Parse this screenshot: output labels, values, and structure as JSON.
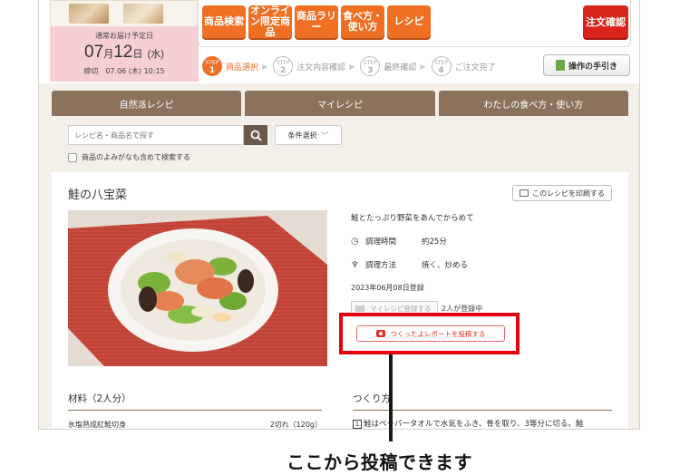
{
  "header": {
    "delivery_label": "通常お届け予定日",
    "delivery_month": "07",
    "delivery_day": "12",
    "delivery_weekday": "(水)",
    "delivery_month_suffix": "月",
    "delivery_day_suffix": "日",
    "deadline": "締切　07.06 (木) 10:15",
    "menu": [
      {
        "label": "商品検索"
      },
      {
        "label": "オンライン限定商品"
      },
      {
        "label": "商品ラリー"
      },
      {
        "label": "食べ方・使い方"
      },
      {
        "label": "レシピ"
      }
    ],
    "order_button": "注文確認",
    "steps": [
      {
        "tag": "STEP",
        "num": "1",
        "label": "商品選択"
      },
      {
        "tag": "STEP",
        "num": "2",
        "label": "注文内容確認"
      },
      {
        "tag": "STEP",
        "num": "3",
        "label": "最終確認"
      },
      {
        "tag": "STEP",
        "num": "4",
        "label": "ご注文完了"
      }
    ],
    "manual_button": "操作の手引き"
  },
  "tabs": [
    "自然派レシピ",
    "マイレシピ",
    "わたしの食べ方・使い方"
  ],
  "search": {
    "placeholder": "レシピ名・商品名で探す",
    "filter_label": "条件選択",
    "kana_label": "商品のよみがなも含めて検索する"
  },
  "recipe": {
    "title": "鮭の八宝菜",
    "print_label": "このレシピを印刷する",
    "description": "鮭とたっぷり野菜をあんでからめて",
    "time_key": "調理時間",
    "time_value": "約25分",
    "method_key": "調理方法",
    "method_value": "焼く、炒める",
    "registered": "2023年06月08日登録",
    "fav_label": "マイレシピ登録する",
    "fav_count": "2人が登録中",
    "report_label": "つくったよレポートを投稿する",
    "ingredients_head": "材料（2人分）",
    "steps_head": "つくり方",
    "ingredient_name": "氷塩熟成紅鮭切身",
    "ingredient_amount": "2切れ（120g）",
    "step1_num": "1",
    "step1_text": "鮭はペーパータオルで水気をふき、骨を取り、3等分に切る。鮭"
  },
  "annotation": {
    "caption": "ここから投稿できます"
  },
  "colors": {
    "accent_orange": "#ef6f23",
    "order_red": "#d9241b",
    "tab_brown": "#8a725d",
    "highlight_red": "#e60012",
    "delivery_pink": "#f6cfd3"
  }
}
